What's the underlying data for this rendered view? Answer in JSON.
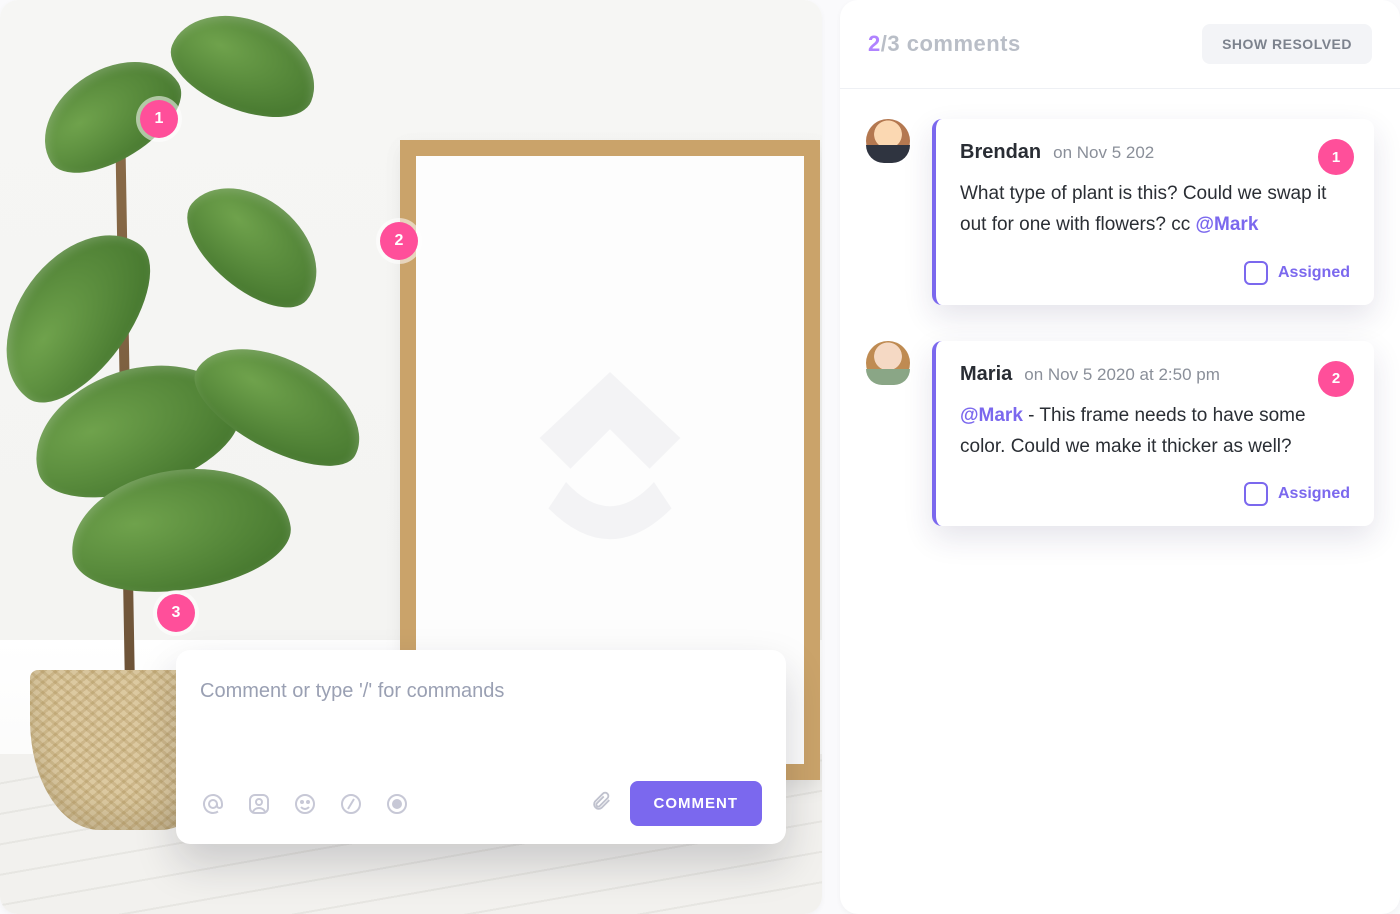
{
  "canvas": {
    "markers": [
      {
        "id": "1",
        "label": "1"
      },
      {
        "id": "2",
        "label": "2"
      },
      {
        "id": "3",
        "label": "3"
      }
    ]
  },
  "composer": {
    "placeholder": "Comment or type '/' for commands",
    "submit_label": "COMMENT",
    "tools": {
      "mention": "mention-icon",
      "assign": "assign-icon",
      "emoji": "emoji-icon",
      "slash": "slash-command-icon",
      "record": "record-icon",
      "attach": "attachment-icon"
    }
  },
  "panel": {
    "header": {
      "active_count": "2",
      "total_text": "/3 comments",
      "resolved_button": "SHOW RESOLVED"
    },
    "comments": [
      {
        "badge": "1",
        "author": "Brendan",
        "date": "on Nov 5 202",
        "body_prefix": "What type of plant is this? Could we swap it out for one with flowers? cc ",
        "mention": "@Mark",
        "body_suffix": "",
        "assigned_label": "Assigned"
      },
      {
        "badge": "2",
        "author": "Maria",
        "date": "on Nov 5 2020 at 2:50 pm",
        "body_prefix": "",
        "mention": "@Mark",
        "body_suffix": " - This frame needs to have some color. Could we make it thicker as well?",
        "assigned_label": "Assigned"
      }
    ]
  }
}
